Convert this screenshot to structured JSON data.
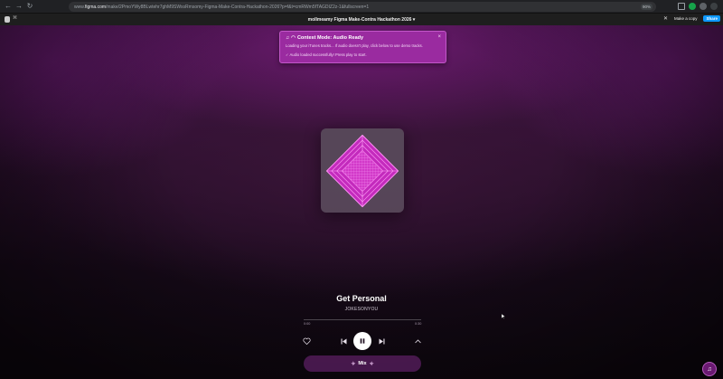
{
  "browser": {
    "url_prefix": "www.",
    "url_host": "figma.com",
    "url_path": "/make/2PmoYWy8BLwtehr7ghM9SWxsRmsomy-Figma-Make-Contra-Hackathon-2026?p=f&t=cmRWm5fTAGDIZ2z-1&fullscreen=1",
    "zoom": "90%"
  },
  "figma": {
    "file_title": "mollmeamy Figma Make-Contra Hackathon 2026",
    "make_copy_label": "Make a copy",
    "share_label": "Share"
  },
  "toast": {
    "title": "Contest Mode: Audio Ready",
    "line1": "Loading your iTunes tracks... If audio doesn't play, click below to use demo tracks.",
    "success": "✓ Audio loaded successfully! Press play to start."
  },
  "player": {
    "track_title": "Get Personal",
    "artist": "JOKESONYOU",
    "time_elapsed": "0:00",
    "time_total": "0:30",
    "progress": 0.0,
    "mix_label": "Mix"
  },
  "colors": {
    "accent": "#9a2ba0",
    "art_pink": "#e24fd9",
    "share_blue": "#0d99ff"
  },
  "icons": [
    "back-icon",
    "forward-icon",
    "reload-icon",
    "shield-icon",
    "star-icon",
    "extensions-icon",
    "heart-icon",
    "previous-icon",
    "pause-icon",
    "next-icon",
    "chevron-up-icon",
    "sparkle-icon",
    "music-note-icon"
  ]
}
